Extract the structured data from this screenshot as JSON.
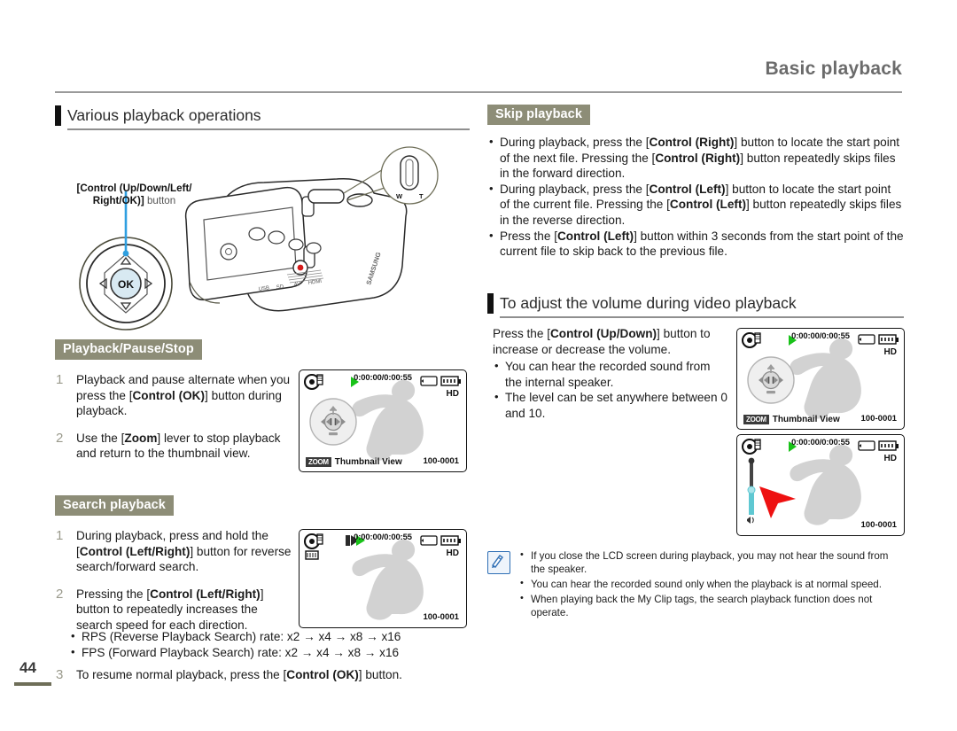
{
  "header": {
    "title": "Basic playback"
  },
  "page": {
    "number": "44"
  },
  "sections": {
    "various": {
      "heading": "Various playback operations"
    },
    "volume": {
      "heading": "To adjust the volume during video playback"
    },
    "skip": {
      "label": "Skip playback"
    },
    "playpause": {
      "label": "Playback/Pause/Stop"
    },
    "search": {
      "label": "Search playback"
    }
  },
  "callout": {
    "line1": "[Control (Up/Down/Left/",
    "line2_bold": "Right/OK)]",
    "line2_light": " button",
    "ok_label": "OK",
    "zoom_w": "W",
    "zoom_t": "T",
    "brand": "SAMSUNG"
  },
  "skip_items": [
    "During playback, press the [Control (Right)] button to locate the start point of the next file. Pressing the [Control (Right)] button repeatedly skips files in the forward direction.",
    "During playback, press the [Control (Left)] button to locate the start point of the current file. Pressing the [Control (Left)] button repeatedly skips files in the reverse direction.",
    "Press the [Control (Left)] button within 3 seconds from the start point of the current file to skip back to the previous file."
  ],
  "playpause_steps": [
    {
      "n": "1",
      "text": "Playback and pause alternate when you press the [Control (OK)] button during playback."
    },
    {
      "n": "2",
      "text": "Use the [Zoom] lever to stop playback and return to the thumbnail view."
    }
  ],
  "search_steps": [
    {
      "n": "1",
      "text": "During playback, press and hold the [Control (Left/Right)] button for reverse search/forward search."
    },
    {
      "n": "2",
      "text": "Pressing the [Control (Left/Right)] button to repeatedly increases the search speed for each direction."
    },
    {
      "n": "3",
      "text": "To resume normal playback, press the [Control (OK)] button."
    }
  ],
  "search_rates": [
    "RPS (Reverse Playback Search) rate: x2 → x4 → x8 → x16",
    "FPS (Forward Playback Search) rate: x2 → x4 → x8 → x16"
  ],
  "volume_text": {
    "intro": "Press the [Control (Up/Down)] button to increase or decrease the volume.",
    "bullets": [
      "You can hear the recorded sound from the internal speaker.",
      "The level can be set anywhere between 0 and 10."
    ]
  },
  "note_items": [
    "If you close the LCD screen during playback, you may not hear the sound from the speaker.",
    "You can hear the recorded sound only when the playback is at normal speed.",
    "When playing back the My Clip tags, the search playback function does not operate."
  ],
  "lcd": {
    "timecode": "0:00:00/0:00:55",
    "hd": "HD",
    "fileno": "100-0001",
    "zoom_tag": "ZOOM",
    "thumbnail_view": "Thumbnail View"
  },
  "colors": {
    "olive": "#8d8d77",
    "olive_rule": "#6e6e58",
    "header_gray": "#6b6b6b",
    "play_green": "#19c219",
    "volume_cyan": "#5fc8d2",
    "cursor_red": "#ee1111",
    "callout_blue": "#2f9fe0",
    "note_blue": "#2f6fb5",
    "silhouette": "#d2d2d2"
  }
}
